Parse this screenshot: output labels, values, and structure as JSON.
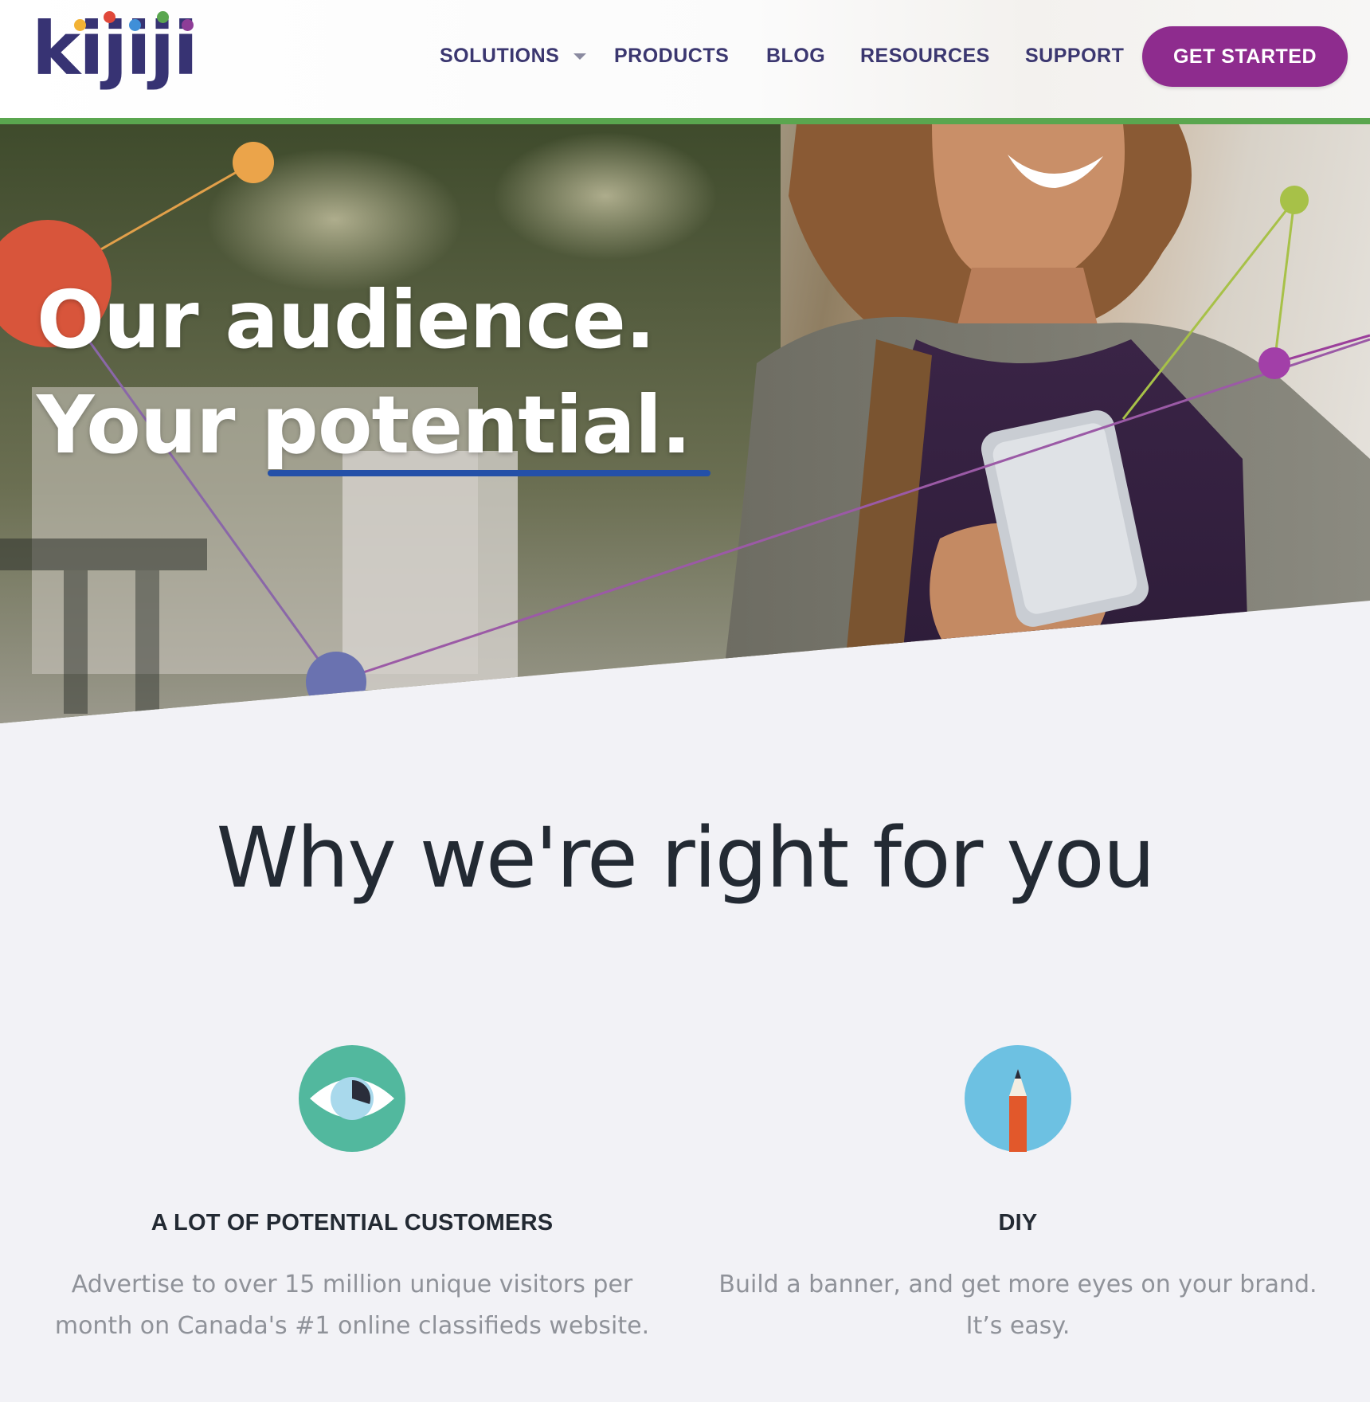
{
  "colors": {
    "brand_navy": "#373373",
    "cta_purple": "#8e2c8e",
    "header_rule_green": "#5aa64f",
    "underline_blue": "#2450a8",
    "eye_icon_green": "#52b89e",
    "pencil_icon_blue": "#6dc1e2",
    "text_dark": "#232a33",
    "text_muted": "#8f9299"
  },
  "header": {
    "logo_text": "kijiji",
    "nav": {
      "solutions": "SOLUTIONS",
      "products": "PRODUCTS",
      "blog": "BLOG",
      "resources": "RESOURCES",
      "support": "SUPPORT"
    },
    "cta_label": "GET STARTED"
  },
  "hero": {
    "line1": "Our audience.",
    "line2": "Your potential."
  },
  "why": {
    "title": "Why we're right for you",
    "features": [
      {
        "icon": "eye-chart-icon",
        "title": "A LOT OF POTENTIAL CUSTOMERS",
        "desc_line1": "Advertise to over 15 million unique visitors per",
        "desc_line2": "month on Canada's #1 online classifieds website."
      },
      {
        "icon": "pencil-icon",
        "title": "DIY",
        "desc_line1": "Build a banner, and get more eyes on your brand.",
        "desc_line2": "It’s easy."
      }
    ]
  }
}
